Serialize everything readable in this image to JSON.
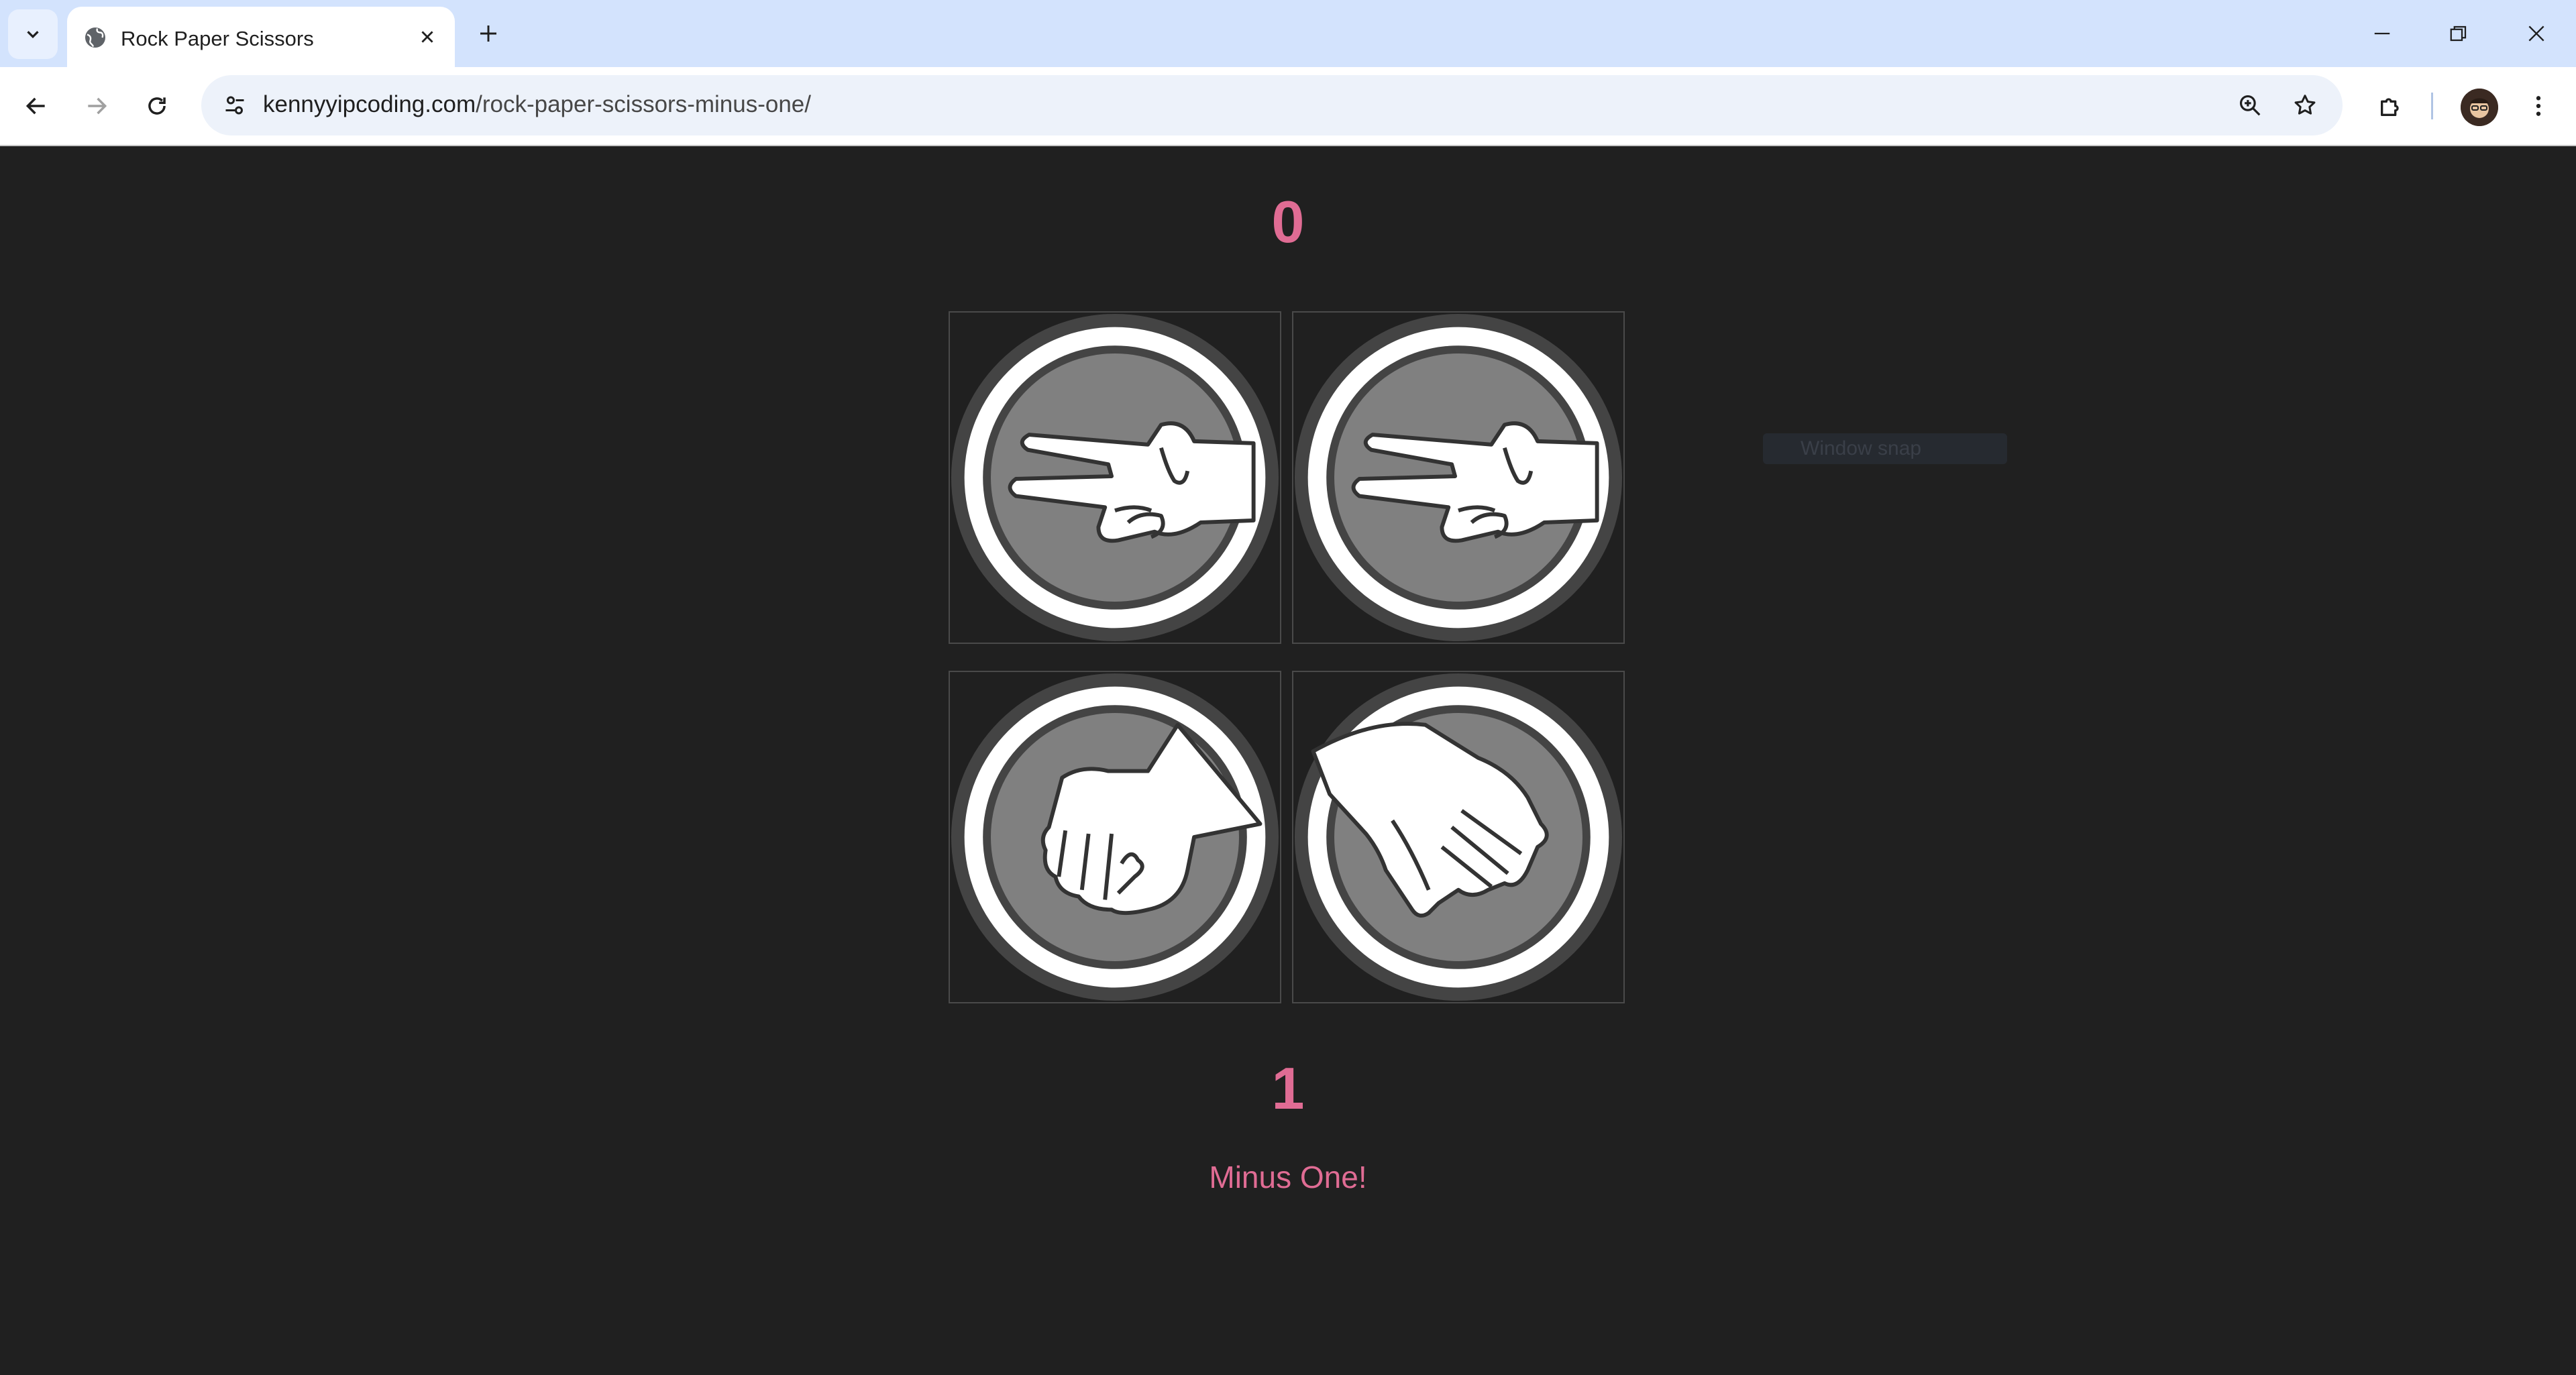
{
  "browser": {
    "tab_title": "Rock Paper Scissors",
    "url_domain": "kennyyipcoding.com",
    "url_path": "/rock-paper-scissors-minus-one/"
  },
  "game": {
    "opponent_score": "0",
    "player_score": "1",
    "message": "Minus One!",
    "opponent_hands": [
      "scissors",
      "scissors"
    ],
    "player_hands": [
      "rock",
      "paper"
    ]
  },
  "overlay": {
    "snap_hint": "Window snap"
  },
  "colors": {
    "accent_pink": "#e06c94",
    "page_background": "#202020"
  }
}
